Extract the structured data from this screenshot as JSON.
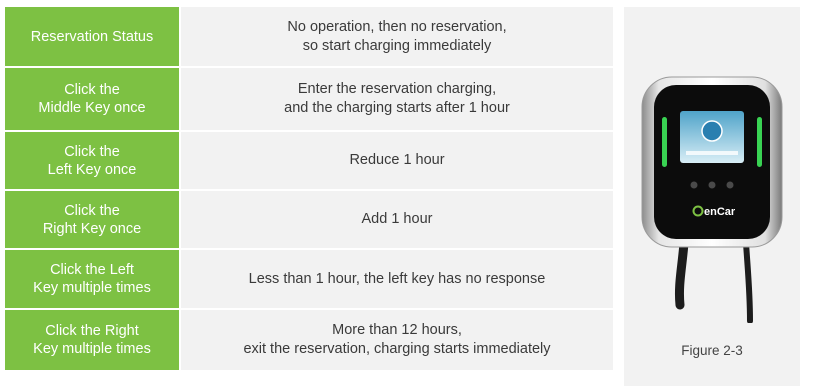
{
  "rows": [
    {
      "key_lines": [
        "Reservation Status"
      ],
      "desc_lines": [
        "No operation, then no reservation,",
        "so start charging immediately"
      ]
    },
    {
      "key_lines": [
        "Click the",
        "Middle Key once"
      ],
      "desc_lines": [
        "Enter the reservation charging,",
        "and the charging starts after 1 hour"
      ]
    },
    {
      "key_lines": [
        "Click the",
        "Left Key once"
      ],
      "desc_lines": [
        "Reduce 1 hour"
      ]
    },
    {
      "key_lines": [
        "Click the",
        "Right Key once"
      ],
      "desc_lines": [
        "Add 1 hour"
      ]
    },
    {
      "key_lines": [
        "Click the Left",
        "Key multiple times"
      ],
      "desc_lines": [
        "Less than 1 hour, the left key has no response"
      ]
    },
    {
      "key_lines": [
        "Click the Right",
        "Key multiple times"
      ],
      "desc_lines": [
        "More than 12 hours,",
        "exit the reservation, charging starts immediately"
      ]
    }
  ],
  "figure": {
    "caption": "Figure 2-3",
    "brand_logo_text": "enCar",
    "colors": {
      "header_green": "#7dc143",
      "cell_gray": "#f2f2f2",
      "led_green": "#39d353"
    }
  }
}
